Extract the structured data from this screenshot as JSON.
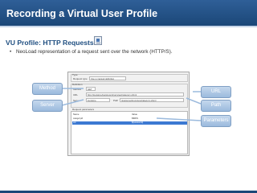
{
  "header": {
    "title": "Recording a Virtual User Profile"
  },
  "section": {
    "title": "VU Profile: HTTP Requests",
    "icon": "http-request-icon"
  },
  "bullet": {
    "text": "NeoLoad representation of a request sent over the network (HTTP/S)."
  },
  "dialog": {
    "type_label": "Type",
    "request_type_label": "Request type",
    "request_type_value": "Use a manual definition",
    "definition_label": "Definition",
    "method_label": "Method",
    "method_value": "GET",
    "url_label": "URL",
    "url_value": "http://jpetstore/jpetstore/shop/viewCategory.shtml",
    "server_label": "Server",
    "server_value": "jpetstore",
    "path_label": "Path",
    "path_value": "/jpetstore/shop/viewCategory.shtml",
    "params_label": "Request parameters",
    "columns": [
      "Name",
      "Value"
    ],
    "rows": [
      {
        "name": "categoryId",
        "value": "BIRDS"
      },
      {
        "name": "sid",
        "value": "${sessionId}"
      }
    ]
  },
  "callouts": {
    "method": "Method",
    "server": "Server",
    "url": "URL",
    "path": "Path",
    "parameters": "Parameters"
  },
  "colors": {
    "header_bg": "#1b4778",
    "title_text": "#1f4e80",
    "callout_bg": "#9bbadd"
  }
}
